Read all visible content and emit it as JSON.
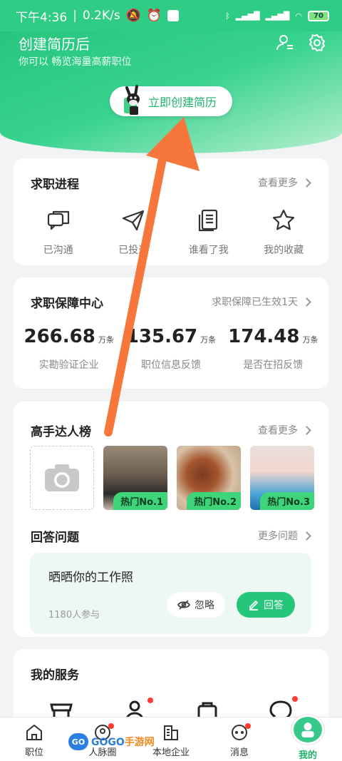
{
  "status": {
    "time": "下午4:36",
    "speed": "0.2K/s",
    "battery": "70"
  },
  "header": {
    "title": "创建简历后",
    "subtitle": "你可以 畅览海量高薪职位",
    "create_button": "立即创建简历"
  },
  "progress": {
    "title": "求职进程",
    "more": "查看更多",
    "items": [
      {
        "label": "已沟通",
        "icon": "chat-icon"
      },
      {
        "label": "已投递",
        "icon": "send-icon"
      },
      {
        "label": "谁看了我",
        "icon": "document-icon"
      },
      {
        "label": "我的收藏",
        "icon": "star-icon"
      }
    ]
  },
  "guarantee": {
    "title": "求职保障中心",
    "more": "求职保障已生效1天",
    "stats": [
      {
        "value": "266.68",
        "unit": "万条",
        "label": "实勘验证企业"
      },
      {
        "value": "135.67",
        "unit": "万条",
        "label": "职位信息反馈"
      },
      {
        "value": "174.48",
        "unit": "万条",
        "label": "是否在招反馈"
      }
    ]
  },
  "experts": {
    "title": "高手达人榜",
    "more": "查看更多",
    "tags": [
      "热门No.1",
      "热门No.2",
      "热门No.3"
    ]
  },
  "questions": {
    "title": "回答问题",
    "more": "更多问题",
    "question": "晒晒你的工作照",
    "count": "1180人参与",
    "ignore": "忽略",
    "answer": "回答"
  },
  "services": {
    "title": "我的服务"
  },
  "tabbar": {
    "tabs": [
      {
        "label": "职位",
        "icon": "home-icon"
      },
      {
        "label": "人脉圈",
        "icon": "network-icon"
      },
      {
        "label": "本地企业",
        "icon": "building-icon"
      },
      {
        "label": "消息",
        "icon": "message-icon"
      },
      {
        "label": "我的",
        "icon": "person-icon"
      }
    ]
  },
  "watermark": {
    "logo": "GO",
    "text_blue": "GOGO",
    "text_orange": "手游网"
  },
  "colors": {
    "brand_green": "#25c67a",
    "arrow_orange": "#f6763c",
    "badge_red": "#ff3b30"
  }
}
